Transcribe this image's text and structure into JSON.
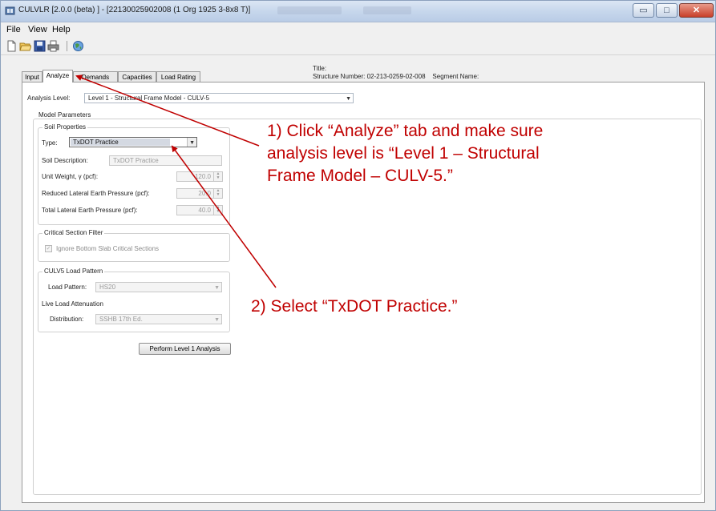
{
  "window": {
    "title": "CULVLR [2.0.0 (beta) ] - [22130025902008 (1 Org 1925 3-8x8 T)]",
    "buttons": {
      "minimize": "▭",
      "maximize": "□",
      "close": "✕"
    }
  },
  "menu": {
    "items": [
      "File",
      "View",
      "Help"
    ]
  },
  "toolbar": {
    "icons": [
      "new-file-icon",
      "open-folder-icon",
      "save-icon",
      "print-icon",
      "globe-icon"
    ]
  },
  "header": {
    "title_label": "Title:",
    "structure_number": "Structure Number: 02-213-0259-02-008",
    "segment_name": "Segment Name:"
  },
  "tabs": [
    "Input",
    "Analyze",
    "Demands",
    "Capacities",
    "Load Rating"
  ],
  "active_tab": "Analyze",
  "analyze": {
    "analysis_level_label": "Analysis Level:",
    "analysis_level_value": "Level 1 - Structural Frame Model - CULV-5",
    "model_parameters_label": "Model Parameters",
    "soil": {
      "group_label": "Soil Properties",
      "type_label": "Type:",
      "type_value": "TxDOT Practice",
      "description_label": "Soil Description:",
      "description_value": "TxDOT Practice",
      "unit_weight_label": "Unit Weight, γ (pcf):",
      "unit_weight_value": "120.0",
      "reduced_pressure_label": "Reduced Lateral Earth Pressure (pcf):",
      "reduced_pressure_value": "20.0",
      "total_pressure_label": "Total Lateral Earth Pressure (pcf):",
      "total_pressure_value": "40.0"
    },
    "critical_section": {
      "group_label": "Critical Section Filter",
      "checkbox_label": "Ignore Bottom Slab Critical Sections",
      "checked": true
    },
    "load_pattern": {
      "group_label": "CULV5 Load Pattern",
      "pattern_label": "Load Pattern:",
      "pattern_value": "HS20",
      "attenuation_label": "Live Load Attenuation",
      "distribution_label": "Distribution:",
      "distribution_value": "SSHB 17th Ed."
    },
    "perform_button": "Perform Level 1 Analysis"
  },
  "annotations": {
    "step1": [
      "1) Click “Analyze” tab and make sure",
      "analysis level is “Level 1 – Structural",
      "Frame Model – CULV-5.”"
    ],
    "step2": "2) Select “TxDOT Practice.”",
    "color": "#c00000"
  },
  "colors": {
    "titlebar": "#c7d7ec",
    "window_bg": "#f0f0f0",
    "annotation_red": "#c00000"
  }
}
